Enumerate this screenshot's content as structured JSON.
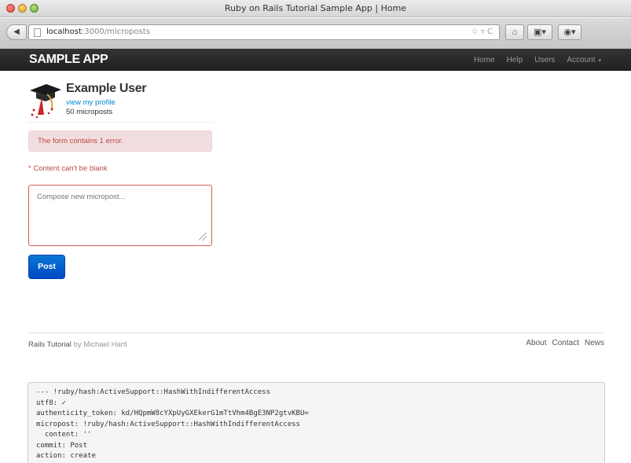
{
  "window": {
    "title": "Ruby on Rails Tutorial Sample App | Home"
  },
  "toolbar": {
    "back_glyph": "◀",
    "url_host": "localhost",
    "url_rest": ":3000/microposts",
    "url_tools": "☆ ▿ C",
    "home_glyph": "⌂",
    "bookmarks_glyph": "▣▾",
    "extra_glyph": "◉▾"
  },
  "navbar": {
    "logo": "SAMPLE APP",
    "links": [
      "Home",
      "Help",
      "Users",
      "Account"
    ],
    "account_caret": "▾"
  },
  "user": {
    "name": "Example User",
    "profile_link": "view my profile",
    "micropost_count": "50 microposts"
  },
  "form": {
    "alert": "The form contains 1 error.",
    "error": "* Content can't be blank",
    "placeholder": "Compose new micropost...",
    "submit": "Post"
  },
  "footer": {
    "brand": "Rails Tutorial",
    "by": "by",
    "author": "Michael Hartl",
    "links": [
      "About",
      "Contact",
      "News"
    ]
  },
  "debug": {
    "lines": [
      "--- !ruby/hash:ActiveSupport::HashWithIndifferentAccess",
      "utf8: ✓",
      "authenticity_token: kd/HQpmW8cYXpUyGXEkerG1mTtVhm4BgE3NP2gtvKBU=",
      "micropost: !ruby/hash:ActiveSupport::HashWithIndifferentAccess",
      "  content: ''",
      "commit: Post",
      "action: create"
    ]
  },
  "colors": {
    "navbar_bg": "#222222",
    "link": "#0088cc",
    "error_text": "#b94a48",
    "alert_bg": "#f2dede",
    "primary_button": "#0055cc"
  },
  "icons": {
    "avatar": "graduation-cap-avatar",
    "back": "back-arrow-icon",
    "home": "home-icon",
    "page": "page-icon"
  }
}
